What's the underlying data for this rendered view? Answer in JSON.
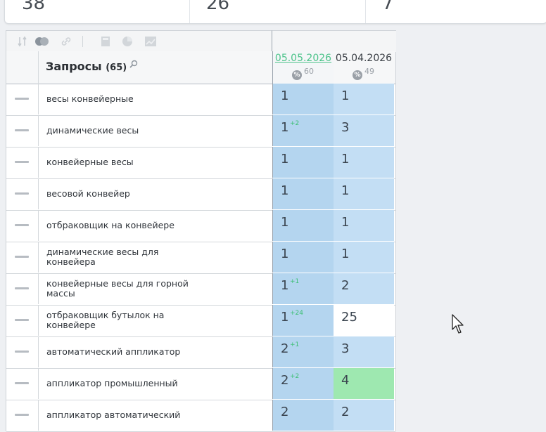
{
  "stats": [
    "38",
    "26",
    "7"
  ],
  "table": {
    "title": "Запросы",
    "count": "(65)",
    "dates": [
      {
        "label": "05.05.2026",
        "badge": "%",
        "sub": "60"
      },
      {
        "label": "05.04.2026",
        "badge": "%",
        "sub": "49"
      }
    ],
    "rows": [
      {
        "keyword": "весы конвейерные",
        "v1": "1",
        "d1": "",
        "v2": "1",
        "c2": "blue"
      },
      {
        "keyword": "динамические весы",
        "v1": "1",
        "d1": "+2",
        "v2": "3",
        "c2": "blue"
      },
      {
        "keyword": "конвейерные весы",
        "v1": "1",
        "d1": "",
        "v2": "1",
        "c2": "blue"
      },
      {
        "keyword": "весовой конвейер",
        "v1": "1",
        "d1": "",
        "v2": "1",
        "c2": "blue"
      },
      {
        "keyword": "отбраковщик на конвейере",
        "v1": "1",
        "d1": "",
        "v2": "1",
        "c2": "blue"
      },
      {
        "keyword": "динамические весы для конвейера",
        "v1": "1",
        "d1": "",
        "v2": "1",
        "c2": "blue"
      },
      {
        "keyword": "конвейерные весы для горной массы",
        "v1": "1",
        "d1": "+1",
        "v2": "2",
        "c2": "blue"
      },
      {
        "keyword": "отбраковщик бутылок на конвейере",
        "v1": "1",
        "d1": "+24",
        "v2": "25",
        "c2": "white"
      },
      {
        "keyword": "автоматический аппликатор",
        "v1": "2",
        "d1": "+1",
        "v2": "3",
        "c2": "blue"
      },
      {
        "keyword": "аппликатор промышленный",
        "v1": "2",
        "d1": "+2",
        "v2": "4",
        "c2": "green"
      },
      {
        "keyword": "аппликатор автоматический",
        "v1": "2",
        "d1": "",
        "v2": "2",
        "c2": "blue"
      }
    ]
  }
}
